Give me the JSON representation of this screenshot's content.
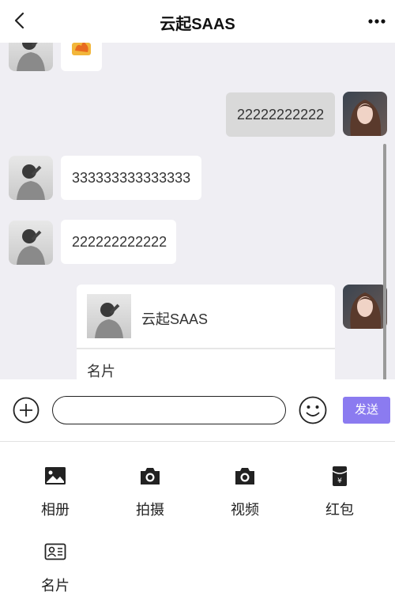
{
  "header": {
    "title": "云起SAAS",
    "back_icon": "chevron-left-icon",
    "more_icon": "more-dots-icon"
  },
  "messages": [
    {
      "side": "left",
      "type": "emoji",
      "content": "fire-emoji"
    },
    {
      "side": "right",
      "type": "text",
      "content": "22222222222"
    },
    {
      "side": "left",
      "type": "text",
      "content": "333333333333333"
    },
    {
      "side": "left",
      "type": "text",
      "content": "222222222222"
    },
    {
      "side": "right",
      "type": "card",
      "card_name": "云起SAAS",
      "card_label": "名片"
    }
  ],
  "input": {
    "placeholder": "",
    "value": "",
    "send_label": "发送"
  },
  "tools": [
    {
      "label": "相册",
      "icon": "image-icon"
    },
    {
      "label": "拍摄",
      "icon": "camera-icon"
    },
    {
      "label": "视频",
      "icon": "video-camera-icon"
    },
    {
      "label": "红包",
      "icon": "red-envelope-icon"
    },
    {
      "label": "名片",
      "icon": "contact-card-icon"
    }
  ],
  "colors": {
    "chat_bg": "#efeef3",
    "send_button": "#8b7bf0",
    "right_bubble": "#d9d9d9"
  }
}
